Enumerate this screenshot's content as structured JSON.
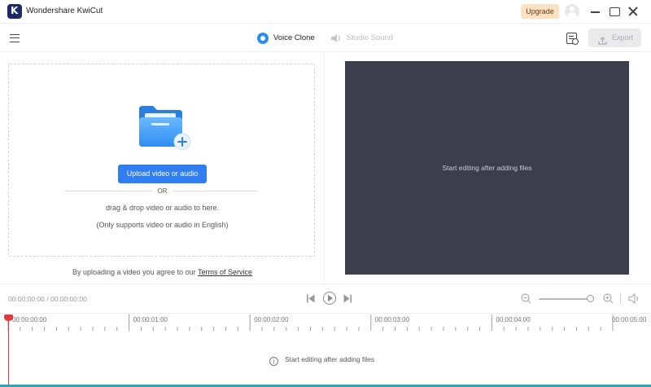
{
  "window": {
    "app_title": "Wondershare KwiCut",
    "logo_letter": "K",
    "upgrade_label": "Upgrade"
  },
  "toolbar": {
    "tabs": [
      {
        "label": "Voice Clone",
        "icon": "voice-clone-icon",
        "active": true
      },
      {
        "label": "Studio Sound",
        "icon": "studio-sound-icon",
        "active": false
      }
    ],
    "export_label": "Export"
  },
  "upload": {
    "button_label": "Upload video or audio",
    "or_label": "OR",
    "drag_text": "drag & drop video or audio to here.",
    "support_text": "(Only supports video or audio in English)",
    "terms_prefix": "By uploading a video you agree to our ",
    "terms_link": "Terms of Service"
  },
  "preview": {
    "placeholder": "Start editing after adding files"
  },
  "playback": {
    "timecode": "00:00:00:00 / 00:00:00:00",
    "zoom_level": 0.93
  },
  "timeline": {
    "tick_labels": [
      "00:00:00:00",
      "00:00:01:00",
      "00:00:02:00",
      "00:00:03:00",
      "00:00:04:00",
      "00:00:05:00"
    ],
    "empty_message": "Start editing after adding files"
  },
  "colors": {
    "accent": "#2f7ef2",
    "upgrade_bg": "#fbe2c3",
    "preview_bg": "#3a3f4b",
    "playhead": "#e23a3a"
  }
}
